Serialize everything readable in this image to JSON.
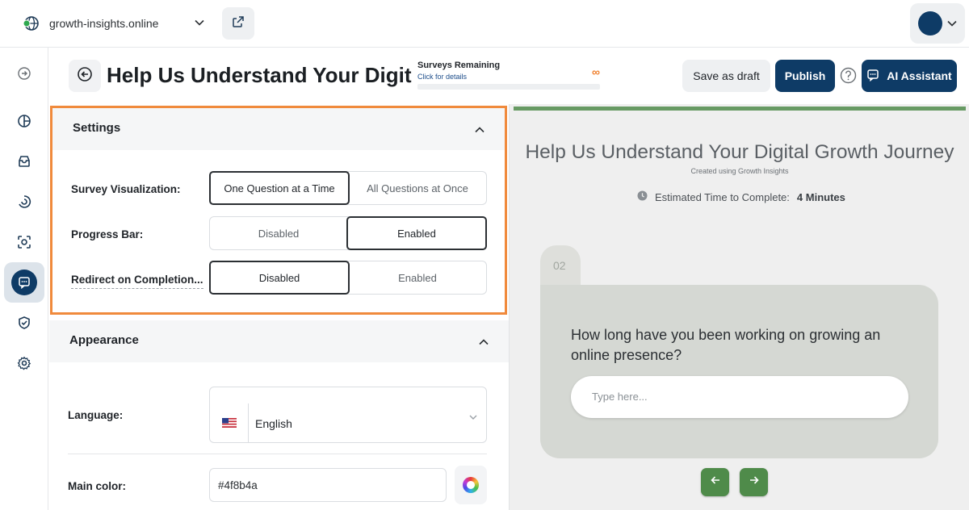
{
  "topbar": {
    "site_name": "growth-insights.online",
    "icons": [
      "globe-icon",
      "chevron-down-icon",
      "external-link-icon",
      "avatar",
      "chevron-down-icon"
    ]
  },
  "sidebar": {
    "items": [
      {
        "name": "collapse-icon",
        "active": false
      },
      {
        "name": "dashboard-icon",
        "active": false
      },
      {
        "name": "inbox-icon",
        "active": false
      },
      {
        "name": "analytics-icon",
        "active": false
      },
      {
        "name": "scan-icon",
        "active": false
      },
      {
        "name": "surveys-icon",
        "active": true
      },
      {
        "name": "shield-check-icon",
        "active": false
      },
      {
        "name": "settings-icon",
        "active": false
      }
    ]
  },
  "header": {
    "title": "Help Us Understand Your Digit",
    "surveys_remaining_label": "Surveys Remaining",
    "surveys_remaining_link": "Click for details",
    "surveys_remaining_value": "∞",
    "save_draft": "Save as draft",
    "publish": "Publish",
    "help": "?",
    "ai_assistant": "AI Assistant"
  },
  "settings": {
    "title": "Settings",
    "rows": [
      {
        "label": "Survey Visualization:",
        "options": [
          "One Question at a Time",
          "All Questions at Once"
        ],
        "selected": 0
      },
      {
        "label": "Progress Bar:",
        "options": [
          "Disabled",
          "Enabled"
        ],
        "selected": 1
      },
      {
        "label": "Redirect on Completion...",
        "options": [
          "Disabled",
          "Enabled"
        ],
        "selected": 0
      }
    ]
  },
  "appearance": {
    "title": "Appearance",
    "language_label": "Language:",
    "language_value": "English",
    "main_color_label": "Main color:",
    "main_color_value": "#4f8b4a"
  },
  "preview": {
    "title": "Help Us Understand Your Digital Growth Journey",
    "subtitle": "Created using Growth Insights",
    "time_label": "Estimated Time to Complete:",
    "time_value": "4 Minutes",
    "question_number": "02",
    "question_text": "How long have you been working on growing an online presence?",
    "input_placeholder": "Type here...",
    "accent_color": "#4f8b4a"
  },
  "colors": {
    "brand": "#0e3b66",
    "highlight": "#f08a3c",
    "accent": "#4f8b4a"
  }
}
